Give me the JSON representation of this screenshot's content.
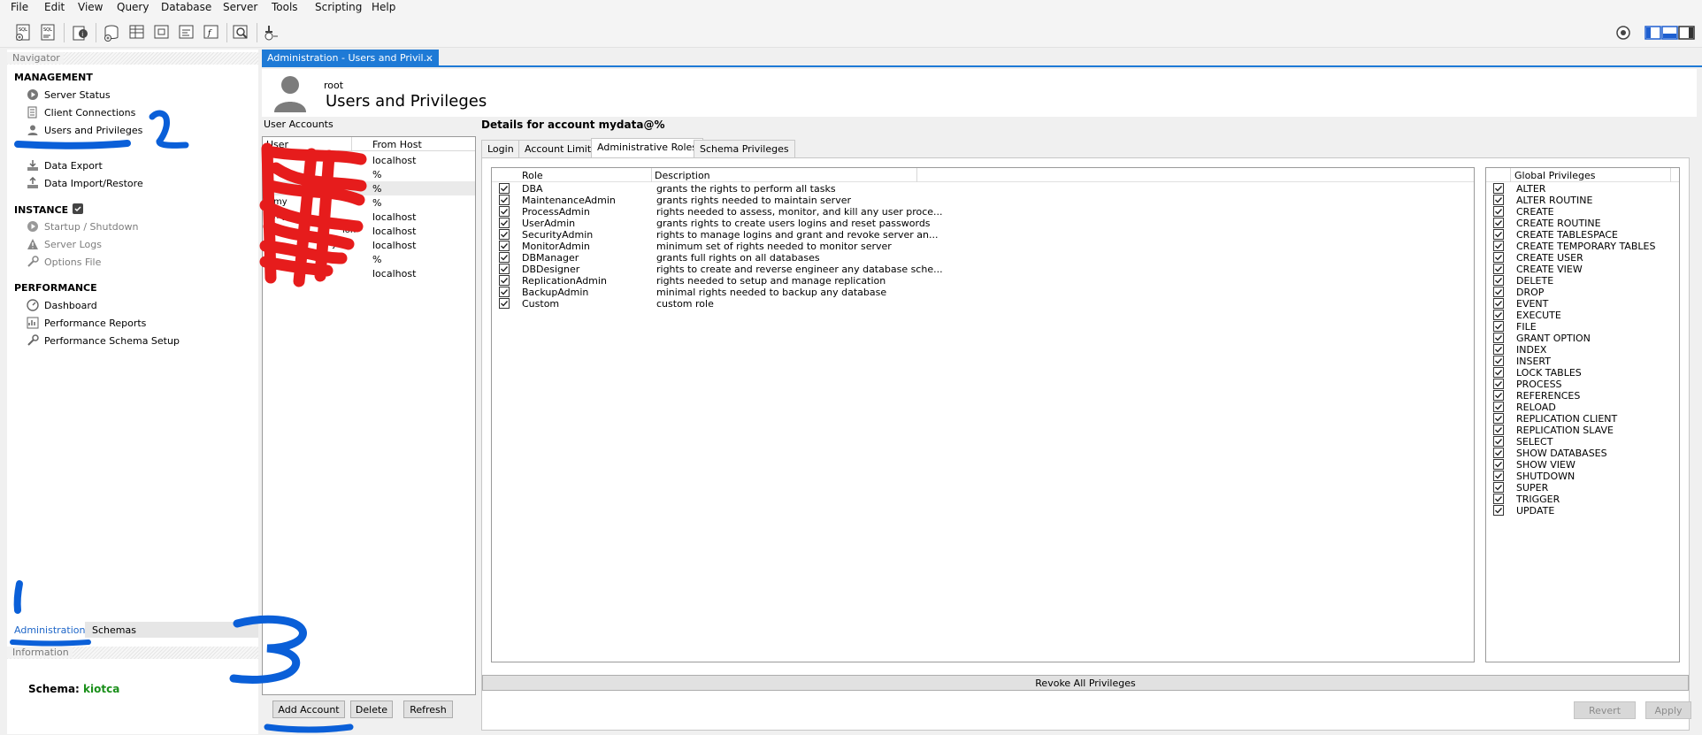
{
  "menu": [
    "File",
    "Edit",
    "View",
    "Query",
    "Database",
    "Server",
    "Tools",
    "Scripting",
    "Help"
  ],
  "navigator": {
    "title": "Navigator",
    "sections": [
      {
        "label": "MANAGEMENT",
        "items": [
          {
            "label": "Server Status",
            "icon": "play-circle-icon"
          },
          {
            "label": "Client Connections",
            "icon": "connections-icon"
          },
          {
            "label": "Users and Privileges",
            "icon": "user-icon"
          },
          {
            "label": "Data Export",
            "icon": "export-icon"
          },
          {
            "label": "Data Import/Restore",
            "icon": "import-icon"
          }
        ]
      },
      {
        "label": "INSTANCE",
        "items": [
          {
            "label": "Startup / Shutdown",
            "icon": "power-icon"
          },
          {
            "label": "Server Logs",
            "icon": "warning-icon"
          },
          {
            "label": "Options File",
            "icon": "wrench-icon"
          }
        ]
      },
      {
        "label": "PERFORMANCE",
        "items": [
          {
            "label": "Dashboard",
            "icon": "gauge-icon"
          },
          {
            "label": "Performance Reports",
            "icon": "reports-icon"
          },
          {
            "label": "Performance Schema Setup",
            "icon": "wrench-icon"
          }
        ]
      }
    ],
    "bottom_tabs": [
      "Administration",
      "Schemas"
    ],
    "information_title": "Information",
    "schema_label": "Schema:",
    "schema_value": "kiotca"
  },
  "document_tab": {
    "label": "Administration - Users and Privil...",
    "close": "×"
  },
  "header": {
    "user": "root",
    "title": "Users and Privileges"
  },
  "user_accounts": {
    "title": "User Accounts",
    "columns": [
      "User",
      "From Host"
    ],
    "rows": [
      {
        "user": "",
        "host": "localhost"
      },
      {
        "user": "",
        "host": "%"
      },
      {
        "user": "",
        "host": "%"
      },
      {
        "user": "",
        "host": "%"
      },
      {
        "user": "",
        "host": "localhost"
      },
      {
        "user": "",
        "host": "localhost"
      },
      {
        "user": "",
        "host": "localhost"
      },
      {
        "user": "",
        "host": "%"
      },
      {
        "user": "",
        "host": "localhost"
      }
    ],
    "visible_user_fragments": [
      "t",
      "r",
      "my",
      "my",
      "my",
      "ion",
      "ys"
    ]
  },
  "details": {
    "title": "Details for account mydata@%",
    "tabs": [
      "Login",
      "Account Limits",
      "Administrative Roles",
      "Schema Privileges"
    ],
    "active_tab": "Administrative Roles",
    "roles_columns": [
      "Role",
      "Description"
    ],
    "roles": [
      {
        "role": "DBA",
        "description": "grants the rights to perform all tasks",
        "checked": true
      },
      {
        "role": "MaintenanceAdmin",
        "description": "grants rights needed to maintain server",
        "checked": true
      },
      {
        "role": "ProcessAdmin",
        "description": "rights needed to assess, monitor, and kill any user proce...",
        "checked": true
      },
      {
        "role": "UserAdmin",
        "description": "grants rights to create users logins and reset passwords",
        "checked": true
      },
      {
        "role": "SecurityAdmin",
        "description": "rights to manage logins and grant and revoke server an...",
        "checked": true
      },
      {
        "role": "MonitorAdmin",
        "description": "minimum set of rights needed to monitor server",
        "checked": true
      },
      {
        "role": "DBManager",
        "description": "grants full rights on all databases",
        "checked": true
      },
      {
        "role": "DBDesigner",
        "description": "rights to create and reverse engineer any database sche...",
        "checked": true
      },
      {
        "role": "ReplicationAdmin",
        "description": "rights needed to setup and manage replication",
        "checked": true
      },
      {
        "role": "BackupAdmin",
        "description": "minimal rights needed to backup any database",
        "checked": true
      },
      {
        "role": "Custom",
        "description": "custom role",
        "checked": true
      }
    ],
    "global_privileges_title": "Global Privileges",
    "global_privileges": [
      "ALTER",
      "ALTER ROUTINE",
      "CREATE",
      "CREATE ROUTINE",
      "CREATE TABLESPACE",
      "CREATE TEMPORARY TABLES",
      "CREATE USER",
      "CREATE VIEW",
      "DELETE",
      "DROP",
      "EVENT",
      "EXECUTE",
      "FILE",
      "GRANT OPTION",
      "INDEX",
      "INSERT",
      "LOCK TABLES",
      "PROCESS",
      "REFERENCES",
      "RELOAD",
      "REPLICATION CLIENT",
      "REPLICATION SLAVE",
      "SELECT",
      "SHOW DATABASES",
      "SHOW VIEW",
      "SHUTDOWN",
      "SUPER",
      "TRIGGER",
      "UPDATE"
    ],
    "revoke_label": "Revoke All Privileges"
  },
  "buttons": {
    "add_account": "Add Account",
    "delete": "Delete",
    "refresh": "Refresh",
    "revert": "Revert",
    "apply": "Apply"
  },
  "annotations": [
    "1",
    "2",
    "3"
  ],
  "colors": {
    "accent": "#1e7ad6",
    "annotation": "#0a5fd8",
    "redaction": "#e61c1c",
    "schema": "#1a8f1a"
  }
}
